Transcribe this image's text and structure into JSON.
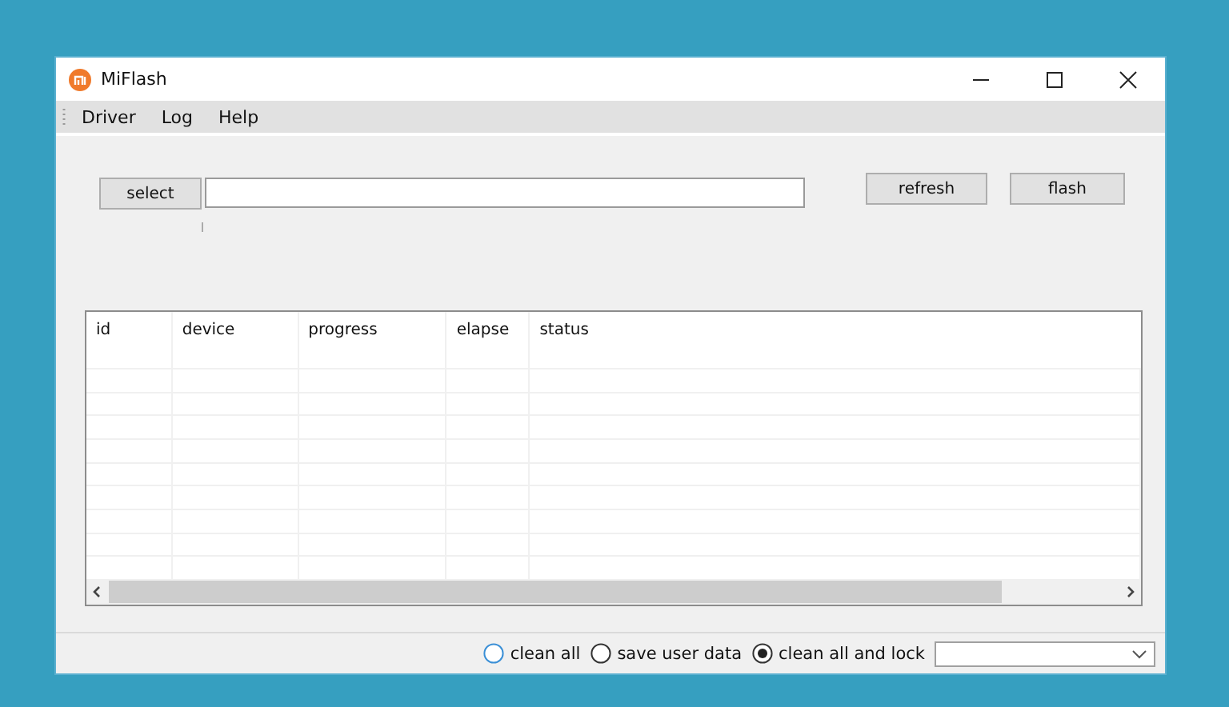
{
  "window": {
    "title": "MiFlash"
  },
  "menu": [
    "Driver",
    "Log",
    "Help"
  ],
  "buttons": {
    "select": "select",
    "refresh": "refresh",
    "flash": "flash"
  },
  "table": {
    "columns": [
      "id",
      "device",
      "progress",
      "elapse",
      "status"
    ]
  },
  "options": [
    {
      "label": "clean all",
      "selected": false
    },
    {
      "label": "save user data",
      "selected": false
    },
    {
      "label": "clean all and lock",
      "selected": true
    }
  ]
}
